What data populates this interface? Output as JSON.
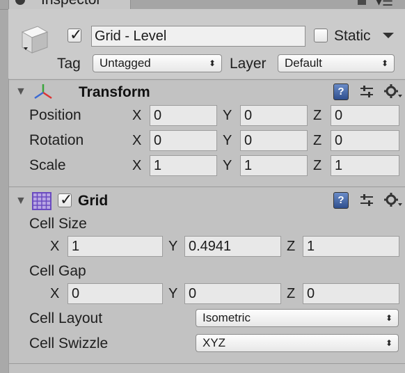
{
  "tab": {
    "title": "Inspector"
  },
  "header": {
    "active": true,
    "name": "Grid - Level",
    "static_label": "Static",
    "static_checked": false,
    "tag_label": "Tag",
    "tag_value": "Untagged",
    "layer_label": "Layer",
    "layer_value": "Default"
  },
  "transform": {
    "title": "Transform",
    "rows": [
      {
        "label": "Position",
        "x": "0",
        "y": "0",
        "z": "0"
      },
      {
        "label": "Rotation",
        "x": "0",
        "y": "0",
        "z": "0"
      },
      {
        "label": "Scale",
        "x": "1",
        "y": "1",
        "z": "1"
      }
    ]
  },
  "grid": {
    "title": "Grid",
    "enabled": true,
    "cell_size_label": "Cell Size",
    "cell_size": {
      "x": "1",
      "y": "0.4941",
      "z": "1"
    },
    "cell_gap_label": "Cell Gap",
    "cell_gap": {
      "x": "0",
      "y": "0",
      "z": "0"
    },
    "cell_layout_label": "Cell Layout",
    "cell_layout_value": "Isometric",
    "cell_swizzle_label": "Cell Swizzle",
    "cell_swizzle_value": "XYZ"
  },
  "axes": {
    "x": "X",
    "y": "Y",
    "z": "Z"
  },
  "icons": {
    "help": "?",
    "preset": "preset-icon",
    "gear": "gear-icon",
    "dropdown_arrow": "⬍",
    "foldout": "▼"
  }
}
